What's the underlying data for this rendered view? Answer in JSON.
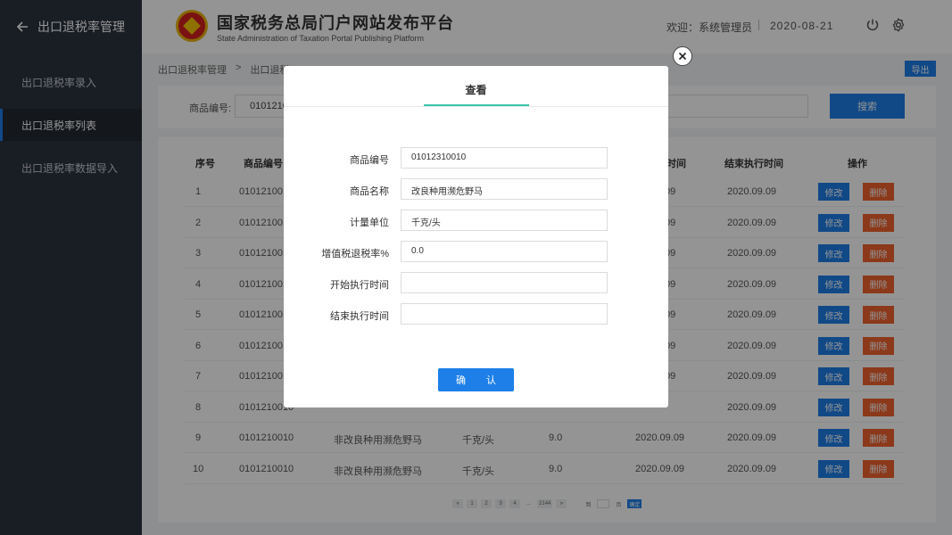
{
  "sidebar": {
    "title": "出口退税率管理",
    "items": [
      {
        "label": "出口退税率录入"
      },
      {
        "label": "出口退税率列表"
      },
      {
        "label": "出口退税率数据导入"
      }
    ]
  },
  "header": {
    "title": "国家税务总局门户网站发布平台",
    "subtitle": "State Administration of Taxation Portal Publishing Platform",
    "welcome": "欢迎：系统管理员",
    "date": "2020-08-21"
  },
  "breadcrumb": {
    "items": [
      "出口退税率管理",
      ">",
      "出口退税"
    ]
  },
  "toolbar": {
    "export_label": "导出"
  },
  "search": {
    "label": "商品编号:",
    "value": "01012100",
    "button": "搜索"
  },
  "table": {
    "headers": {
      "index": "序号",
      "code": "商品编号",
      "end_time": "结束执行时间",
      "actions": "操作",
      "start_time_partial": "时间"
    },
    "rows": [
      {
        "idx": "1",
        "code": "0101210010",
        "date": "2020.09.09"
      },
      {
        "idx": "2",
        "code": "0101210010",
        "date": "2020.09.09"
      },
      {
        "idx": "3",
        "code": "0101210010",
        "date": "2020.09.09"
      },
      {
        "idx": "4",
        "code": "0101210010",
        "date": "2020.09.09"
      },
      {
        "idx": "5",
        "code": "0101210010",
        "date": "2020.09.09"
      },
      {
        "idx": "6",
        "code": "0101210010",
        "date": "2020.09.09"
      },
      {
        "idx": "7",
        "code": "0101210010",
        "date": "2020.09.09"
      },
      {
        "idx": "8",
        "code": "0101210010",
        "date": "2020.09.09"
      },
      {
        "idx": "9",
        "code": "0101210010",
        "name": "非改良种用濒危野马",
        "unit": "千克/头",
        "rate": "9.0",
        "start": "2020.09.09",
        "date": "2020.09.09"
      },
      {
        "idx": "10",
        "code": "0101210010",
        "name": "非改良种用濒危野马",
        "unit": "千克/头",
        "rate": "9.0",
        "start": "2020.09.09",
        "date": "2020.09.09"
      }
    ],
    "partial_start": [
      "09",
      "09",
      "09",
      "09",
      "09",
      "09",
      "09"
    ],
    "edit_label": "修改",
    "delete_label": "删除"
  },
  "pagination": {
    "prev": "«",
    "pages": [
      "1",
      "2",
      "3",
      "4"
    ],
    "ellipsis": "...",
    "last": "2144",
    "next": "»",
    "go_to": "到",
    "page_unit": "页",
    "go_button": "确定"
  },
  "modal": {
    "title": "查看",
    "fields": [
      {
        "label": "商品编号",
        "value": "01012310010"
      },
      {
        "label": "商品名称",
        "value": "改良种用濒危野马"
      },
      {
        "label": "计量单位",
        "value": "千克/头"
      },
      {
        "label": "增值税退税率%",
        "value": "0.0"
      },
      {
        "label": "开始执行时间",
        "value": ""
      },
      {
        "label": "结束执行时间",
        "value": ""
      }
    ],
    "confirm": "确 认"
  },
  "colors": {
    "primary": "#1e7fe8",
    "danger": "#f0622e",
    "accent": "#3bc4a9",
    "sidebar": "#2b333e"
  }
}
